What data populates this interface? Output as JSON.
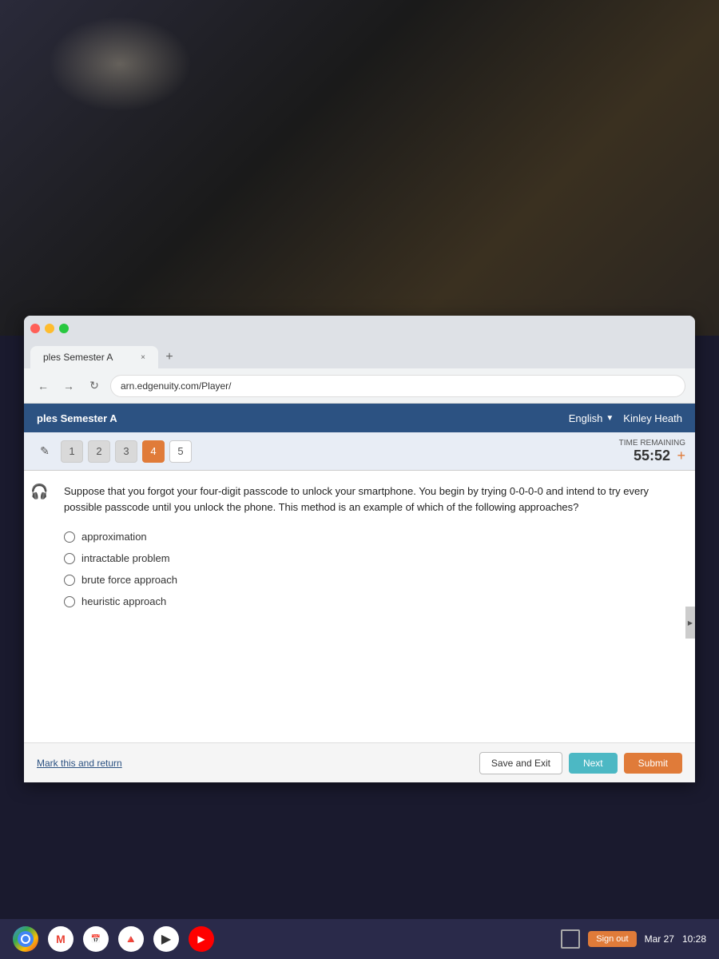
{
  "photo_bg": {
    "description": "dark background photo area"
  },
  "browser": {
    "tab_label": "ples Semester A",
    "tab_close": "×",
    "new_tab": "+",
    "address": "arn.edgenuity.com/Player/",
    "nav_back": "←",
    "nav_forward": "→",
    "nav_refresh": "↻",
    "window_controls": {
      "close": "×",
      "minimize": "–",
      "maximize": "⬜"
    }
  },
  "app": {
    "header": {
      "title": "ples Semester A",
      "language_label": "English",
      "chevron": "▼",
      "user_name": "Kinley Heath"
    },
    "question_nav": {
      "edit_icon": "✎",
      "questions": [
        {
          "number": "1",
          "state": "normal"
        },
        {
          "number": "2",
          "state": "normal"
        },
        {
          "number": "3",
          "state": "normal"
        },
        {
          "number": "4",
          "state": "active"
        },
        {
          "number": "5",
          "state": "white"
        }
      ],
      "timer_label": "TIME REMAINING",
      "timer_value": "55:52",
      "timer_plus": "+"
    },
    "question": {
      "text": "Suppose that you forgot your four-digit passcode to unlock your smartphone. You begin by trying 0-0-0-0 and intend to try every possible passcode until you unlock the phone. This method is an example of which of the following approaches?",
      "options": [
        {
          "id": "A",
          "label": "approximation"
        },
        {
          "id": "B",
          "label": "intractable problem"
        },
        {
          "id": "C",
          "label": "brute force approach"
        },
        {
          "id": "D",
          "label": "heuristic approach"
        }
      ]
    },
    "action_bar": {
      "mark_return": "Mark this and return",
      "save_exit_label": "Save and Exit",
      "next_label": "Next",
      "submit_label": "Submit"
    }
  },
  "taskbar": {
    "icons": [
      {
        "name": "chrome-icon",
        "type": "chrome",
        "label": "Chrome"
      },
      {
        "name": "gmail-icon",
        "type": "gmail",
        "label": "M"
      },
      {
        "name": "calendar-icon",
        "type": "calendar",
        "label": "▣"
      },
      {
        "name": "drive-icon",
        "type": "drive",
        "label": "📁"
      },
      {
        "name": "play-icon",
        "type": "play",
        "label": "▶"
      },
      {
        "name": "youtube-icon",
        "type": "youtube",
        "label": "▶"
      }
    ],
    "screen_icon": "⬜",
    "sign_out_label": "Sign out",
    "date": "Mar 27",
    "time": "10:28"
  }
}
